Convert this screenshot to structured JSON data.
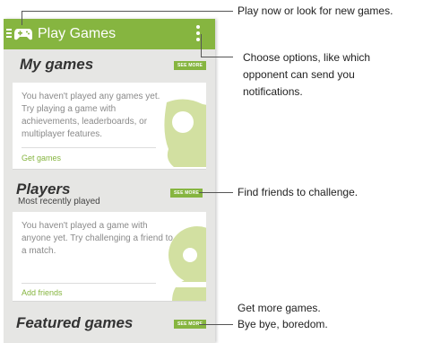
{
  "appbar": {
    "title": "Play Games"
  },
  "my_games": {
    "title": "My games",
    "see_more": "SEE MORE",
    "card_text": "You haven't played any games yet. Try playing a game with achievements, leaderboards, or multiplayer features.",
    "link": "Get games"
  },
  "players": {
    "title": "Players",
    "subtitle": "Most recently played",
    "see_more": "SEE MORE",
    "card_text": "You haven't played a game with anyone yet. Try challenging a friend to a match.",
    "link": "Add friends"
  },
  "featured": {
    "title": "Featured games",
    "see_more": "SEE MORE"
  },
  "callouts": {
    "top": "Play now or look for new games.",
    "options_1": "Choose options, like which",
    "options_2": "opponent can send you",
    "options_3": "notifications.",
    "friends": "Find friends to challenge.",
    "more_1": "Get more games.",
    "more_2": "Bye bye, boredom."
  },
  "colors": {
    "accent": "#86b540",
    "art": "#d2e0a1"
  }
}
